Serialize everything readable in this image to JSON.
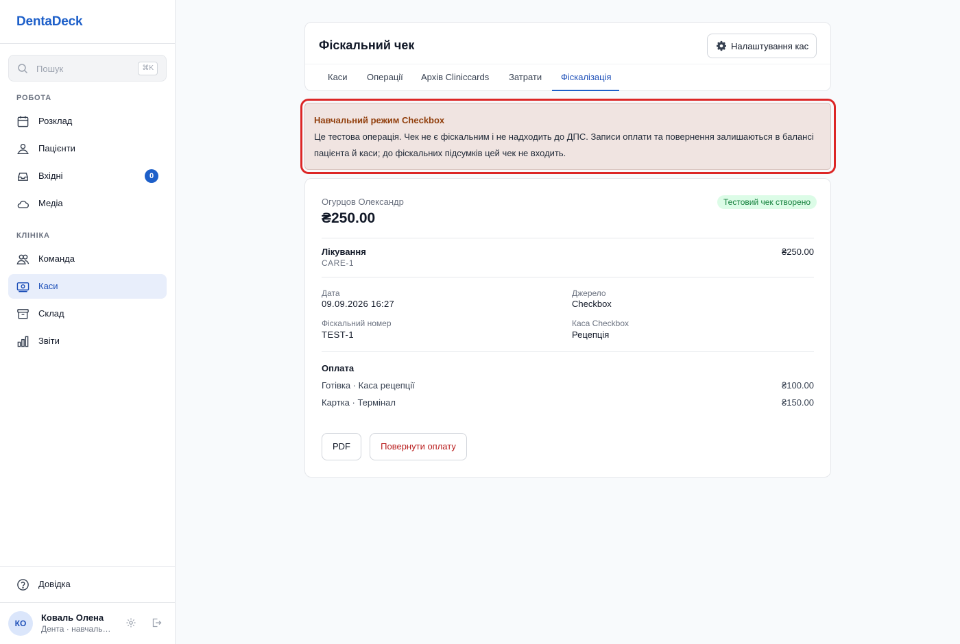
{
  "brand": "DentaDeck",
  "search": {
    "placeholder": "Пошук",
    "shortcut": "⌘K"
  },
  "sidebar": {
    "section_work": "РОБОТА",
    "section_clinic": "КЛІНІКА",
    "items": [
      {
        "label": "Розклад",
        "icon": "calendar-icon"
      },
      {
        "label": "Пацієнти",
        "icon": "patients-icon"
      },
      {
        "label": "Вхідні",
        "icon": "inbox-icon",
        "badge": "0"
      },
      {
        "label": "Медіа",
        "icon": "cloud-icon"
      },
      {
        "label": "Команда",
        "icon": "team-icon"
      },
      {
        "label": "Каси",
        "icon": "cash-register-icon",
        "active": true
      },
      {
        "label": "Склад",
        "icon": "archive-icon"
      },
      {
        "label": "Звіти",
        "icon": "bar-chart-icon"
      }
    ],
    "help_label": "Довідка",
    "user": {
      "initials": "КО",
      "name": "Коваль Олена",
      "role": "Дента · навчальний режим"
    }
  },
  "header": {
    "title": "Фіскальний чек",
    "settings_button": "Налаштування кас",
    "tabs": [
      {
        "label": "Каси"
      },
      {
        "label": "Операції"
      },
      {
        "label": "Архів Cliniccards"
      },
      {
        "label": "Затрати"
      },
      {
        "label": "Фіскалізація",
        "active": true
      }
    ]
  },
  "warning": {
    "title": "Навчальний режим Checkbox",
    "text": "Це тестова операція. Чек не є фіскальним і не надходить до ДПС. Записи оплати та повернення залишаються в балансі пацієнта й каси; до фіскальних підсумків цей чек не входить."
  },
  "receipt": {
    "patient": "Огурцов Олександр",
    "amount": "₴250.00",
    "status": "Тестовий чек створено",
    "service": {
      "name": "Лікування",
      "code": "CARE-1",
      "price": "₴250.00"
    },
    "details": {
      "date_label": "Дата",
      "date_value": "09.09.2026 16:27",
      "source_label": "Джерело",
      "source_value": "Checkbox",
      "fiscal_label": "Фіскальний номер",
      "fiscal_value": "TEST-1",
      "register_label": "Каса Checkbox",
      "register_value": "Рецепція"
    },
    "payment_title": "Оплата",
    "payments": [
      {
        "method": "Готівка · Каса рецепції",
        "amount": "₴100.00"
      },
      {
        "method": "Картка · Термінал",
        "amount": "₴150.00"
      }
    ],
    "pdf_button": "PDF",
    "refund_button": "Повернути оплату"
  },
  "colors": {
    "accent": "#1d5fc9",
    "warning_bg": "#f0e4e1",
    "warning_title": "#92400e",
    "success_bg": "#dcfce7",
    "success_text": "#15803d",
    "danger": "#b91c1c"
  }
}
